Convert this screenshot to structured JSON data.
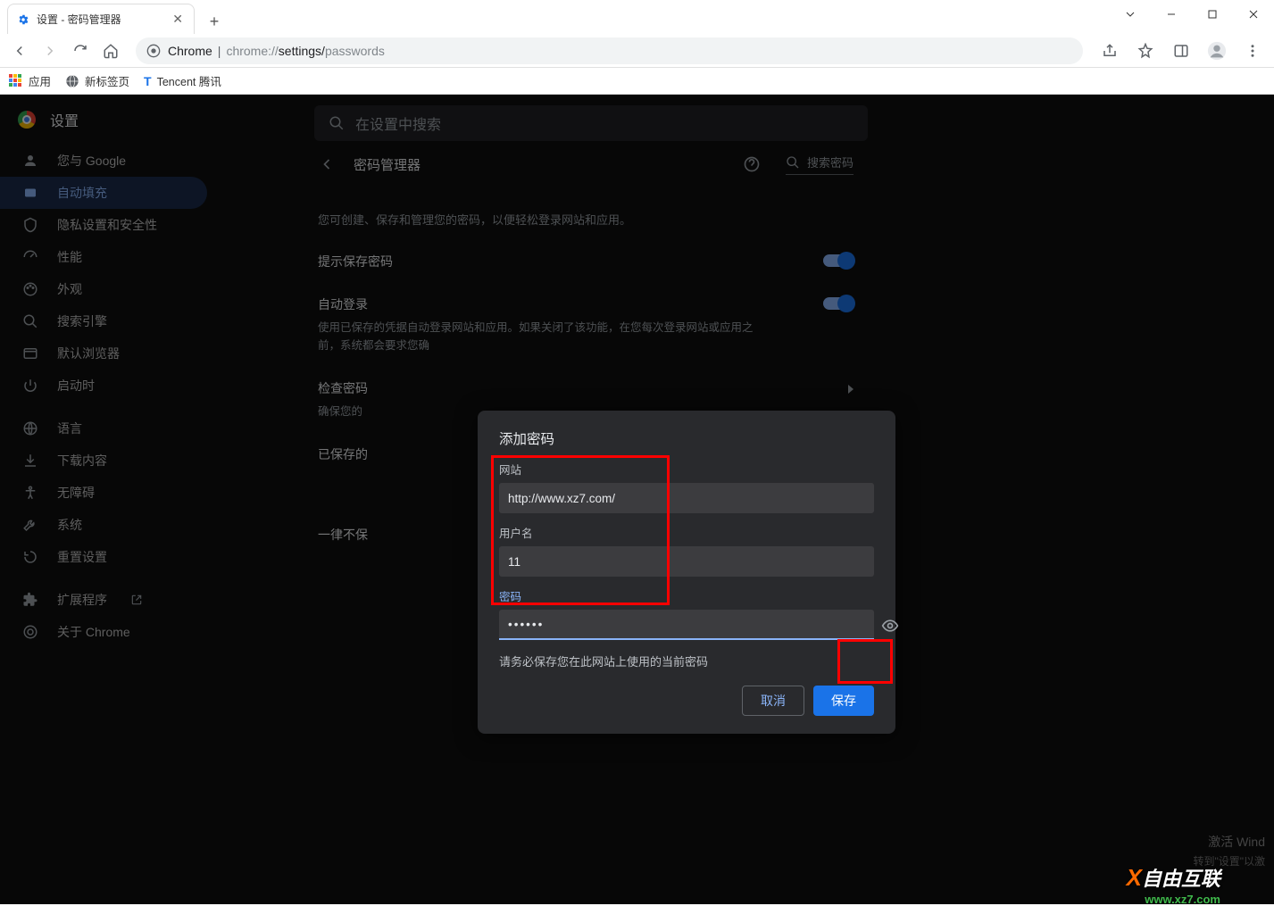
{
  "window": {
    "tab_title": "设置 - 密码管理器"
  },
  "toolbar": {
    "chrome_label": "Chrome",
    "url_prefix": "chrome://",
    "url_mid": "settings/",
    "url_end": "passwords"
  },
  "bookmarks": {
    "apps": "应用",
    "newtab": "新标签页",
    "tencent": "Tencent 腾讯"
  },
  "sidebar": {
    "title": "设置",
    "items": [
      {
        "label": "您与 Google"
      },
      {
        "label": "自动填充"
      },
      {
        "label": "隐私设置和安全性"
      },
      {
        "label": "性能"
      },
      {
        "label": "外观"
      },
      {
        "label": "搜索引擎"
      },
      {
        "label": "默认浏览器"
      },
      {
        "label": "启动时"
      },
      {
        "label": "语言"
      },
      {
        "label": "下载内容"
      },
      {
        "label": "无障碍"
      },
      {
        "label": "系统"
      },
      {
        "label": "重置设置"
      },
      {
        "label": "扩展程序"
      },
      {
        "label": "关于 Chrome"
      }
    ]
  },
  "search": {
    "placeholder": "在设置中搜索"
  },
  "page": {
    "title": "密码管理器",
    "search_placeholder": "搜索密码",
    "desc": "您可创建、保存和管理您的密码，以便轻松登录网站和应用。",
    "offer_save": "提示保存密码",
    "auto_login": "自动登录",
    "auto_login_sub": "使用已保存的凭据自动登录网站和应用。如果关闭了该功能，在您每次登录网站或应用之前，系统都会要求您确",
    "check_pw": "检查密码",
    "check_pw_sub": "确保您的",
    "saved_list": "已保存的",
    "saved_item": "已",
    "never_row": "一律不保"
  },
  "dialog": {
    "title": "添加密码",
    "site_label": "网站",
    "site_value": "http://www.xz7.com/",
    "user_label": "用户名",
    "user_value": "11",
    "pw_label": "密码",
    "pw_value": "••••••",
    "hint": "请务必保存您在此网站上使用的当前密码",
    "cancel": "取消",
    "save": "保存"
  },
  "watermark": {
    "activate": "激活 Wind",
    "goto": "转到\"设置\"以激",
    "brand": "自由互联",
    "url": "www.xz7.com"
  }
}
